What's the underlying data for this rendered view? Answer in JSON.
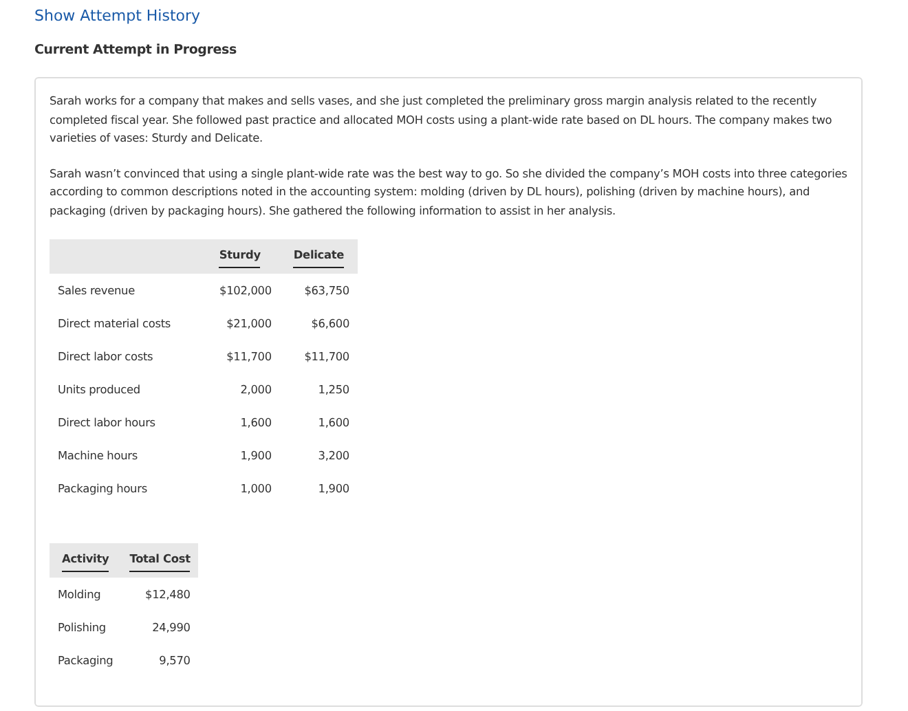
{
  "attempt_history_link": "Show Attempt History",
  "heading": "Current Attempt in Progress",
  "paragraphs": [
    "Sarah works for a company that makes and sells vases, and she just completed the preliminary gross margin analysis related to the recently completed fiscal year. She followed past practice and allocated MOH costs using a plant-wide rate based on DL hours. The company makes two varieties of vases: Sturdy and Delicate.",
    "Sarah wasn’t convinced that using a single plant-wide rate was the best way to go. So she divided the company’s MOH costs into three categories according to common descriptions noted in the accounting system: molding (driven by DL hours), polishing (driven by machine hours), and packaging (driven by packaging hours). She gathered the following information to assist in her analysis."
  ],
  "product_table": {
    "columns": [
      "Sturdy",
      "Delicate"
    ],
    "rows": [
      {
        "label": "Sales revenue",
        "values": [
          "$102,000",
          "$63,750"
        ]
      },
      {
        "label": "Direct material costs",
        "values": [
          "$21,000",
          "$6,600"
        ]
      },
      {
        "label": "Direct labor costs",
        "values": [
          "$11,700",
          "$11,700"
        ]
      },
      {
        "label": "Units produced",
        "values": [
          "2,000",
          "1,250"
        ]
      },
      {
        "label": "Direct labor hours",
        "values": [
          "1,600",
          "1,600"
        ]
      },
      {
        "label": "Machine hours",
        "values": [
          "1,900",
          "3,200"
        ]
      },
      {
        "label": "Packaging hours",
        "values": [
          "1,000",
          "1,900"
        ]
      }
    ]
  },
  "activity_table": {
    "columns": [
      "Activity",
      "Total Cost"
    ],
    "rows": [
      {
        "label": "Molding",
        "value": "$12,480"
      },
      {
        "label": "Polishing",
        "value": "24,990"
      },
      {
        "label": "Packaging",
        "value": "9,570"
      }
    ]
  }
}
